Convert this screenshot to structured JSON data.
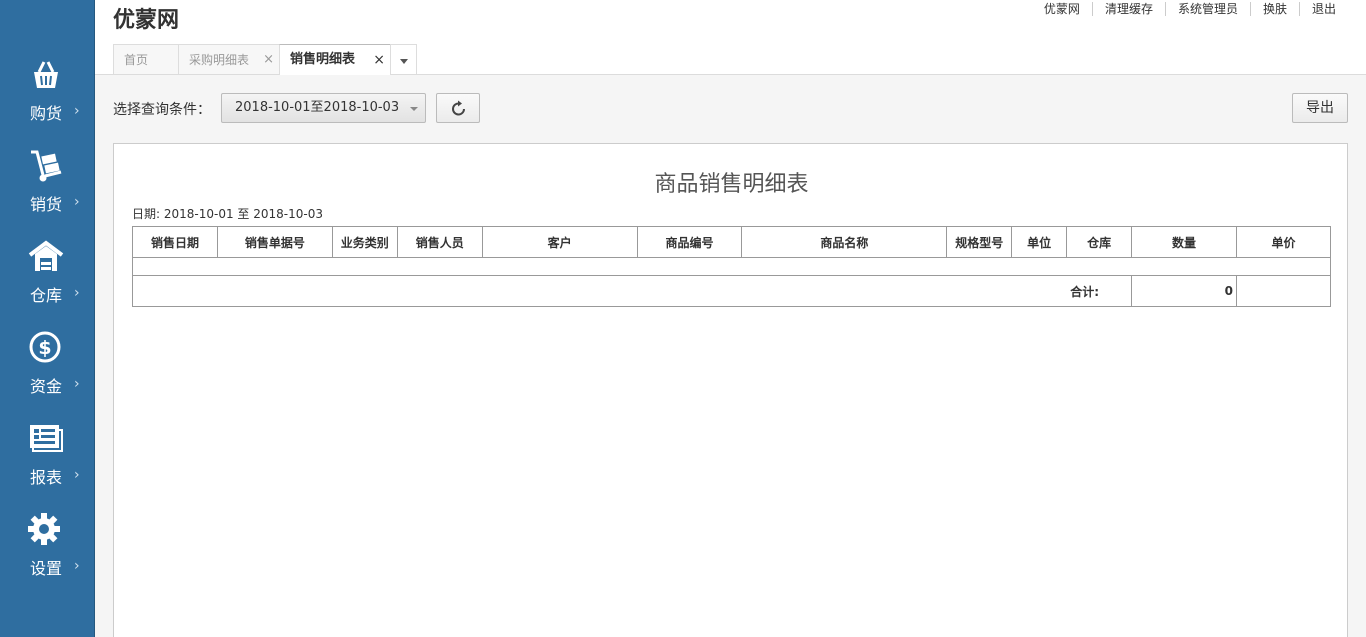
{
  "brand": "优蒙网",
  "top_links": [
    "优蒙网",
    "清理缓存",
    "系统管理员",
    "换肤",
    "退出"
  ],
  "sidebar": {
    "items": [
      {
        "label": "购货",
        "icon": "basket-icon"
      },
      {
        "label": "销货",
        "icon": "hand-truck-icon"
      },
      {
        "label": "仓库",
        "icon": "warehouse-icon"
      },
      {
        "label": "资金",
        "icon": "dollar-icon"
      },
      {
        "label": "报表",
        "icon": "report-icon"
      },
      {
        "label": "设置",
        "icon": "gear-icon"
      }
    ],
    "chevron": "›"
  },
  "tabs": [
    {
      "label": "首页",
      "closable": false,
      "active": false
    },
    {
      "label": "采购明细表",
      "closable": true,
      "active": false
    },
    {
      "label": "销售明细表",
      "closable": true,
      "active": true
    }
  ],
  "tab_close_glyph": "×",
  "toolbar": {
    "filter_label": "选择查询条件：",
    "date_range_value": "2018-10-01至2018-10-03",
    "export_label": "导出"
  },
  "report": {
    "title": "商品销售明细表",
    "date_line": "日期: 2018-10-01 至 2018-10-03",
    "columns": [
      "销售日期",
      "销售单据号",
      "业务类别",
      "销售人员",
      "客户",
      "商品编号",
      "商品名称",
      "规格型号",
      "单位",
      "仓库",
      "数量",
      "单价"
    ],
    "total_label": "合计:",
    "total_quantity": "0"
  },
  "colors": {
    "sidebar_bg": "#2f6ea0",
    "header_bg": "#ffffff",
    "page_bg": "#f5f5f5"
  }
}
